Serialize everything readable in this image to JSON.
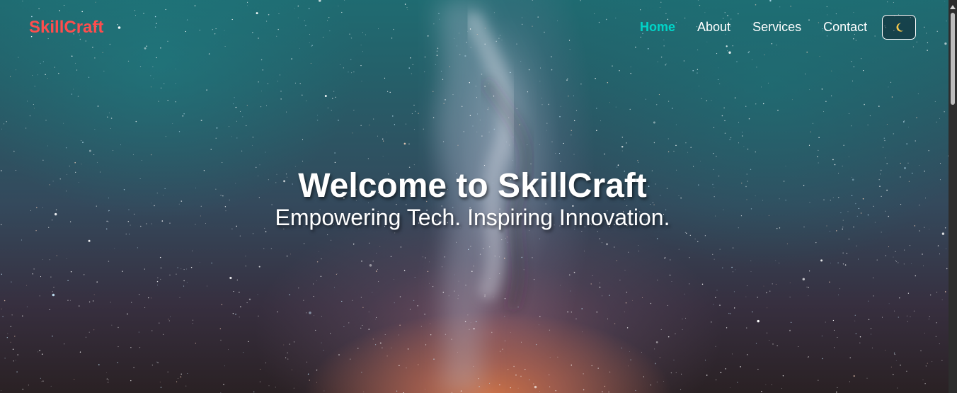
{
  "brand": {
    "name": "SkillCraft"
  },
  "nav": {
    "items": [
      {
        "label": "Home",
        "active": true
      },
      {
        "label": "About",
        "active": false
      },
      {
        "label": "Services",
        "active": false
      },
      {
        "label": "Contact",
        "active": false
      }
    ],
    "theme_toggle": {
      "icon": "moon-icon"
    }
  },
  "hero": {
    "title": "Welcome to SkillCraft",
    "subtitle": "Empowering Tech. Inspiring Innovation."
  },
  "colors": {
    "brand": "#ff4d4d",
    "nav_active": "#00d4c8",
    "nav_text": "#ffffff",
    "hero_text": "#ffffff",
    "scrollbar_track": "#2d2d2d",
    "scrollbar_thumb": "#bdbdbd"
  }
}
